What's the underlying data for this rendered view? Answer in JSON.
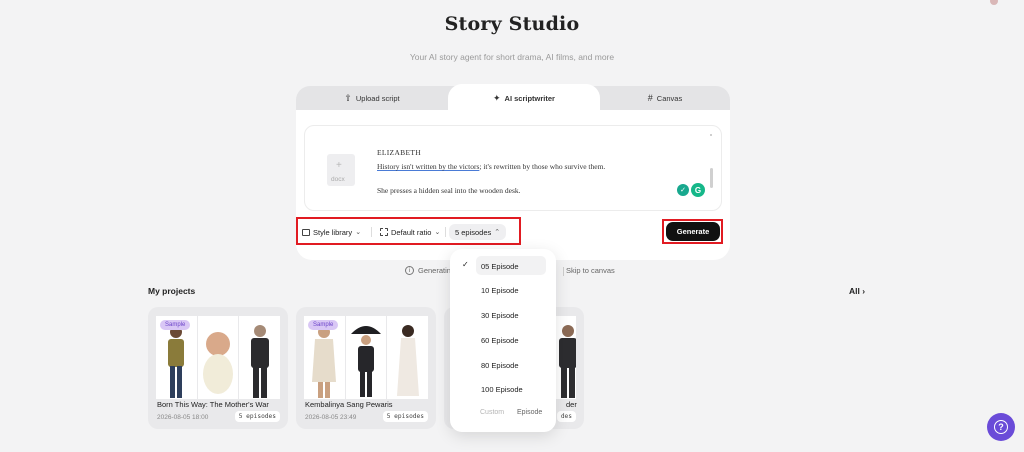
{
  "header": {
    "title": "Story Studio",
    "subtitle": "Your AI story agent for short drama, AI films, and more"
  },
  "tabs": [
    {
      "label": "Upload script",
      "icon": "upload-icon",
      "active": false
    },
    {
      "label": "AI scriptwriter",
      "icon": "sparkle-icon",
      "active": true
    },
    {
      "label": "Canvas",
      "icon": "grid-icon",
      "active": false
    }
  ],
  "editor": {
    "file_label": "docx",
    "character": "ELIZABETH",
    "dialogue_underlined": "History isn't written by the victors",
    "dialogue_rest": "; it's rewritten by those who survive them.",
    "action": "She presses a hidden seal into the wooden desk."
  },
  "controls": {
    "style_library": "Style library",
    "ratio": "Default ratio",
    "episodes": "5 episodes",
    "generate": "Generate"
  },
  "status": {
    "generating": "Generatin",
    "skip": "Skip to canvas"
  },
  "projects": {
    "heading": "My projects",
    "all": "All",
    "items": [
      {
        "badge": "Sample",
        "title": "Born This Way: The Mother's War",
        "date": "2026-08-05 18:00",
        "episodes": "5 episodes"
      },
      {
        "badge": "Sample",
        "title": "Kembalinya Sang Pewaris",
        "date": "2026-08-05 23:49",
        "episodes": "5 episodes"
      },
      {
        "badge": "",
        "title": "der",
        "date": "",
        "episodes": "des"
      }
    ]
  },
  "dropdown": {
    "options": [
      "05 Episode",
      "10 Episode",
      "30 Episode",
      "60 Episode",
      "80 Episode",
      "100 Episode"
    ],
    "selected": "05 Episode",
    "custom_placeholder": "Custom",
    "custom_suffix": "Episode"
  },
  "colors": {
    "accent_purple": "#6a4bd8",
    "highlight_red": "#e11b22",
    "generate_bg": "#111111"
  }
}
